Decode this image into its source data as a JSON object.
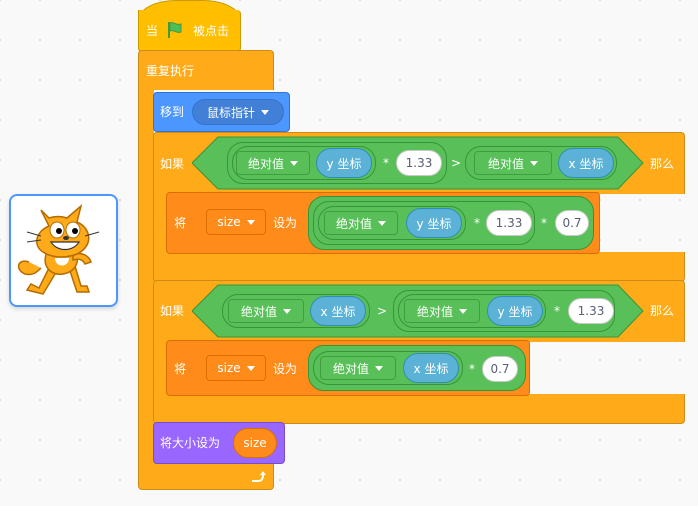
{
  "colors": {
    "events": "#ffbf00",
    "control": "#ffab19",
    "motion": "#4c97ff",
    "operators": "#59c059",
    "sensing": "#5cb1d6",
    "variables": "#ff8c1a",
    "looks": "#9966ff"
  },
  "hat": {
    "when": "当",
    "flag_icon": "green-flag-icon",
    "clicked": "被点击"
  },
  "forever": {
    "label": "重复执行",
    "arrow_icon": "loop-arrow-icon"
  },
  "goto": {
    "label": "移到",
    "target": "鼠标指针"
  },
  "if1": {
    "if_label": "如果",
    "then_label": "那么",
    "left_abs": "绝对值",
    "left_reporter": "y 坐标",
    "times": "*",
    "factor": "1.33",
    "gt": ">",
    "right_abs": "绝对值",
    "right_reporter": "x 坐标",
    "set_label": "将",
    "var": "size",
    "set_to": "设为",
    "set_abs": "绝对值",
    "set_reporter": "y 坐标",
    "set_times1": "*",
    "set_factor": "1.33",
    "set_times2": "*",
    "set_scale": "0.7"
  },
  "if2": {
    "if_label": "如果",
    "then_label": "那么",
    "left_abs": "绝对值",
    "left_reporter": "x 坐标",
    "gt": ">",
    "right_abs": "绝对值",
    "right_reporter": "y 坐标",
    "times": "*",
    "factor": "1.33",
    "set_label": "将",
    "var": "size",
    "set_to": "设为",
    "set_abs": "绝对值",
    "set_reporter": "x 坐标",
    "set_times": "*",
    "set_scale": "0.7"
  },
  "setsize": {
    "label": "将大小设为",
    "var": "size"
  },
  "sprite": {
    "name": "cat-sprite-thumbnail"
  }
}
